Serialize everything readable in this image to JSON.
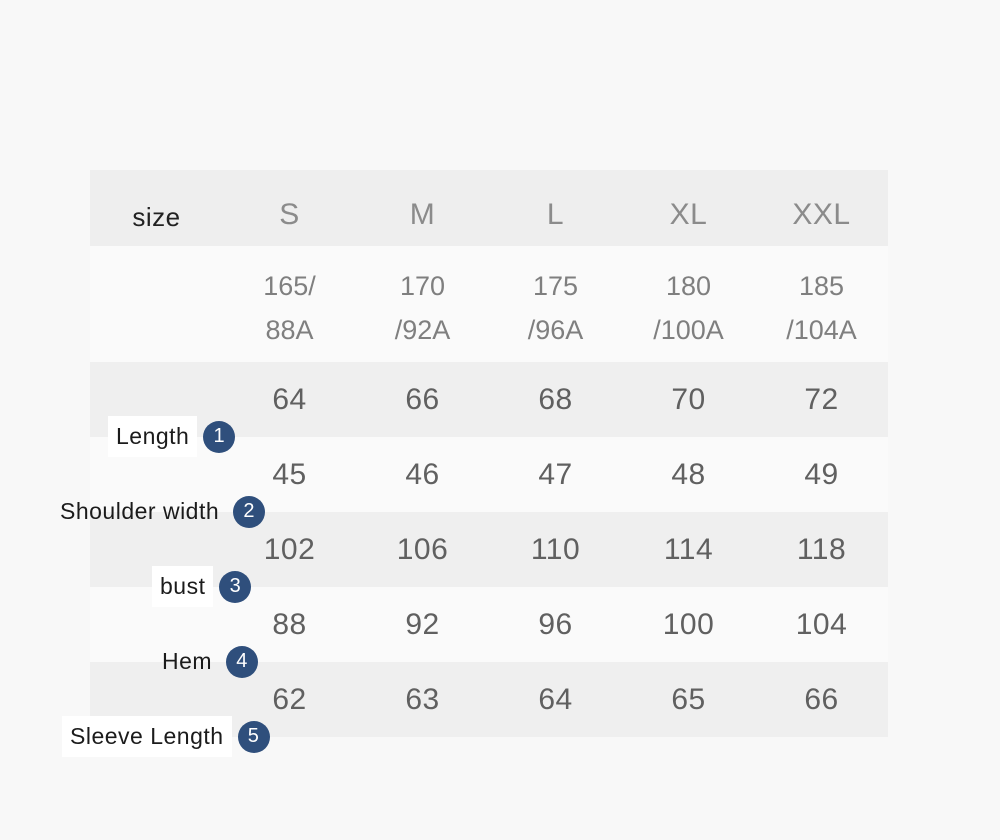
{
  "table": {
    "header_label": "size",
    "sizes": [
      "S",
      "M",
      "L",
      "XL",
      "XXL"
    ],
    "size_codes": [
      {
        "line1": "165/",
        "line2": "88A"
      },
      {
        "line1": "170",
        "line2": "/92A"
      },
      {
        "line1": "175",
        "line2": "/96A"
      },
      {
        "line1": "180",
        "line2": "/100A"
      },
      {
        "line1": "185",
        "line2": "/104A"
      }
    ],
    "rows": [
      {
        "badge": "1",
        "label": "Length",
        "values": [
          "64",
          "66",
          "68",
          "70",
          "72"
        ]
      },
      {
        "badge": "2",
        "label": "Shoulder width",
        "values": [
          "45",
          "46",
          "47",
          "48",
          "49"
        ]
      },
      {
        "badge": "3",
        "label": "bust",
        "values": [
          "102",
          "106",
          "110",
          "114",
          "118"
        ]
      },
      {
        "badge": "4",
        "label": "Hem",
        "values": [
          "88",
          "92",
          "96",
          "100",
          "104"
        ]
      },
      {
        "badge": "5",
        "label": "Sleeve Length",
        "values": [
          "62",
          "63",
          "64",
          "65",
          "66"
        ]
      }
    ]
  },
  "colors": {
    "page_background": "#f8f8f8",
    "header_background": "#eeeeee",
    "row_odd_background": "#efefef",
    "row_even_background": "#fafafa",
    "badge_background": "#2f4f7c",
    "badge_text": "#ffffff",
    "value_text": "#606060",
    "label_text": "#1b1b1b",
    "size_header_text": "#8b8b8b"
  }
}
